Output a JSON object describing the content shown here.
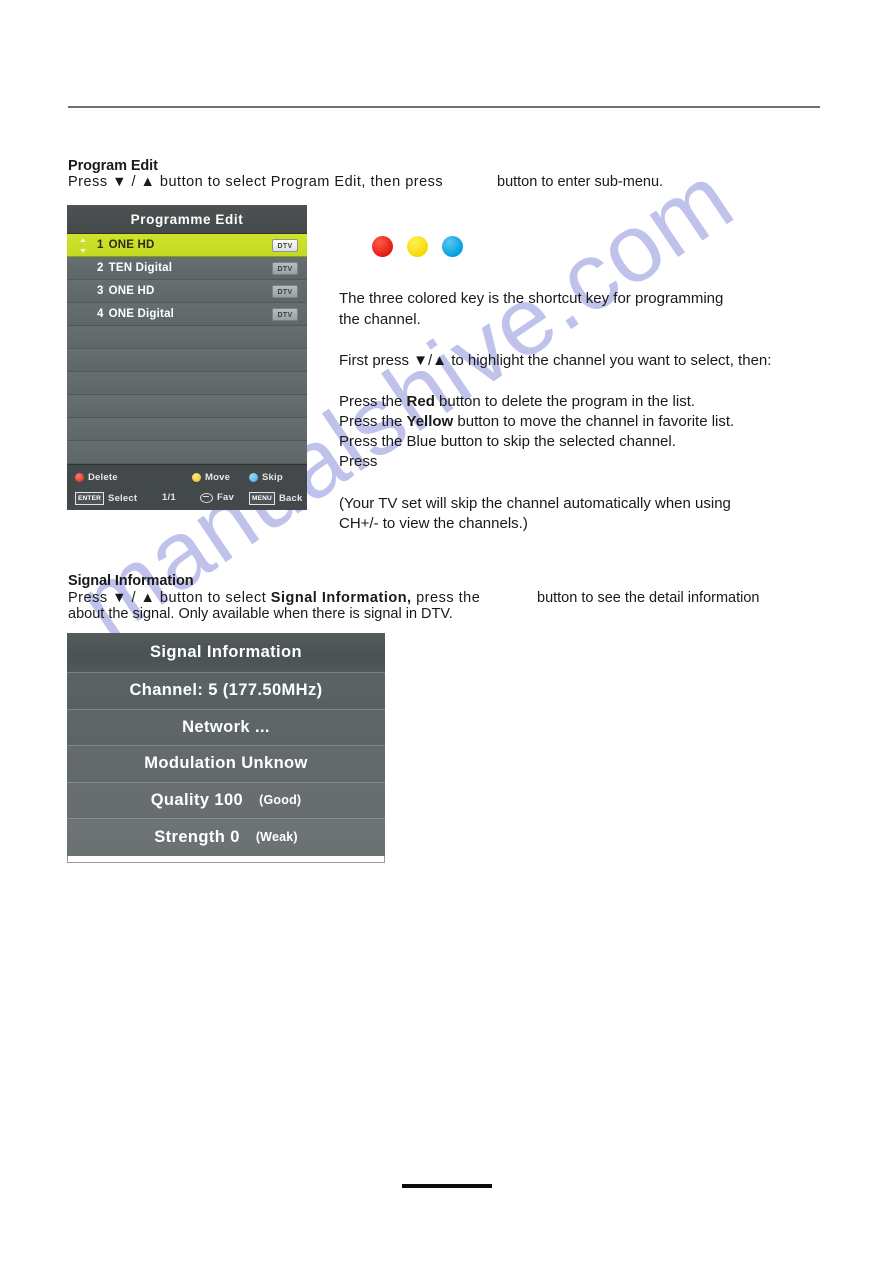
{
  "page": {
    "watermark": "manualshive.com"
  },
  "program_edit": {
    "heading": "Program Edit",
    "intro_a": "Press ▼ / ▲ button to select Program Edit,  then press",
    "intro_b": "button to enter sub-menu.",
    "osd": {
      "title": "Programme Edit",
      "rows": [
        {
          "number": "1",
          "name": "ONE HD",
          "badge": "DTV",
          "selected": true
        },
        {
          "number": "2",
          "name": "TEN Digital",
          "badge": "DTV",
          "selected": false
        },
        {
          "number": "3",
          "name": "ONE HD",
          "badge": "DTV",
          "selected": false
        },
        {
          "number": "4",
          "name": "ONE Digital",
          "badge": "DTV",
          "selected": false
        }
      ],
      "empty_row_count": 6,
      "footer": {
        "delete": "Delete",
        "move": "Move",
        "skip": "Skip",
        "enter_key": "ENTER",
        "select": "Select",
        "page": "1/1",
        "fav": "Fav",
        "menu_key": "MENU",
        "back": "Back"
      }
    },
    "color_keys": [
      {
        "name": "red-key",
        "color": "#e11b12"
      },
      {
        "name": "yellow-key",
        "color": "#f5d900"
      },
      {
        "name": "blue-key",
        "color": "#00a0e0"
      }
    ],
    "notes": {
      "line1": "The three colored key is the shortcut key for programming",
      "line2": " the channel.",
      "line3": "First press  ▼/▲ to highlight the channel you want to select, then:",
      "red_pre": "Press the ",
      "red_word": "Red",
      "red_post": " button to delete the program in the list.",
      "yellow_pre": "Press the ",
      "yellow_word": "Yellow",
      "yellow_post": " button to move the channel in favorite list.",
      "blue_line": "Press the Blue button to skip the selected channel.",
      "press_line": "Press",
      "paren1": "(Your TV set will skip the channel automatically  when using",
      "paren2": " CH+/- to view the channels.)"
    }
  },
  "signal_information": {
    "heading": "Signal Information",
    "intro_a": "Press ▼ / ▲ button to select ",
    "intro_bold": "Signal Information,",
    "intro_b": " press the",
    "intro_c": "button to see the detail information",
    "intro_d": "about the signal. Only available when there is signal in DTV.",
    "osd": {
      "title": "Signal Information",
      "channel": "Channel: 5 (177.50MHz)",
      "network": "Network ...",
      "modulation": "Modulation Unknow",
      "quality": "Quality 100",
      "quality_note": "(Good)",
      "strength": "Strength 0",
      "strength_note": "(Weak)"
    }
  }
}
